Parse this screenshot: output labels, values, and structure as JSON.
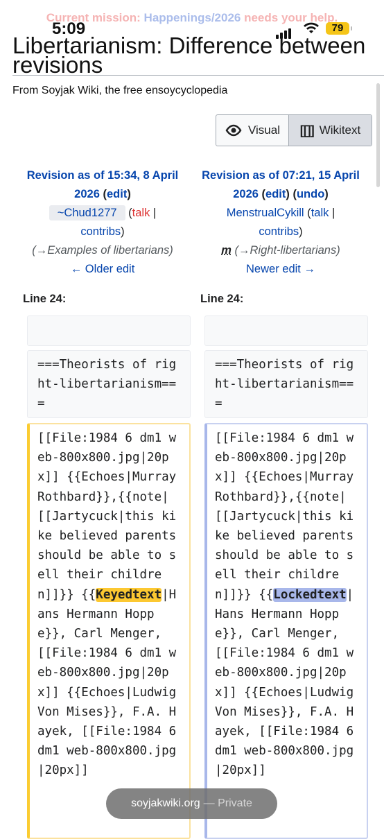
{
  "banner": {
    "prefix": "Current mission: ",
    "link": "Happenings/2026",
    "suffix": " needs your help."
  },
  "status": {
    "time": "5:09",
    "battery": "79"
  },
  "page": {
    "title": "Libertarianism: Difference between revisions",
    "subtitle": "From Soyjak Wiki, the free ensoycyclopedia"
  },
  "toggle": {
    "visual": "Visual",
    "wikitext_icon": "[[]]",
    "wikitext": "Wikitext"
  },
  "left_rev": {
    "header": "Revision as of 15:34, 8 April 2026",
    "edit_open": " (",
    "edit": "edit",
    "edit_close": ")",
    "user": "~Chud1277",
    "talk_open": " (",
    "talk": "talk",
    "sep": " |",
    "contribs": "contribs",
    "close": ")",
    "summary_arrow": "→",
    "summary": "Examples of libertarians",
    "nav": "← Older edit"
  },
  "right_rev": {
    "header": "Revision as of 07:21, 15 April 2026",
    "edit": "edit",
    "undo": "undo",
    "user": "MenstrualCykill",
    "talk": "talk",
    "sep": " |",
    "contribs": "contribs",
    "minor": "m",
    "summary_arrow": "→",
    "summary": "Right-libertarians",
    "nav": "Newer edit →"
  },
  "diff": {
    "left_line": "Line 24:",
    "right_line": "Line 24:",
    "context_line": "===Theorists of right-libertarianism===",
    "code_before": "[[File:1984 6 dm1 web-800x800.jpg|20px]] {{Echoes|Murray Rothbard}},{{note|[[Jartycuck|this kike believed parents should be able to sell their children]]}} {{",
    "left_changed": "Keyedtext",
    "right_changed": "Lockedtext",
    "code_after": "|Hans Hermann Hoppe}}, Carl Menger, [[File:1984 6 dm1 web-800x800.jpg|20px]] {{Echoes|Ludwig Von Mises}}, F.A. Hayek, [[File:1984 6 dm1 web-800x800.jpg|20px]]"
  },
  "url_pill": {
    "host": "soyjakwiki.org",
    "mode": "— Private"
  }
}
